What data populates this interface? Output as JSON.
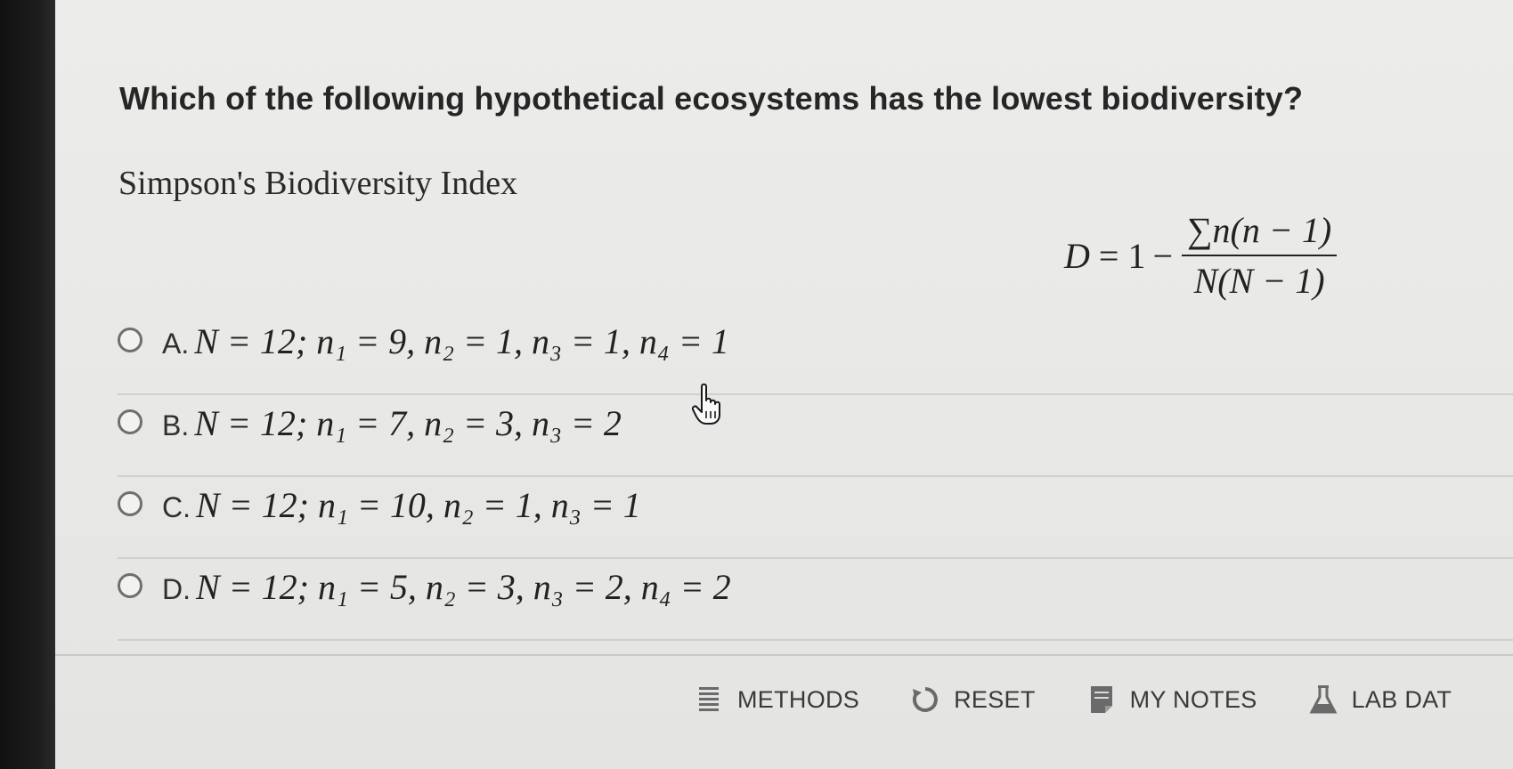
{
  "question": "Which of the following hypothetical ecosystems has the lowest biodiversity?",
  "index_title": "Simpson's Biodiversity Index",
  "formula": {
    "lhs": "D",
    "equals": "=",
    "one": "1",
    "minus": "−",
    "numerator": "∑n(n − 1)",
    "denominator": "N(N − 1)"
  },
  "options": [
    {
      "letter": "A.",
      "expression": "N = 12; n₁ = 9, n₂ = 1, n₃ = 1, n₄ = 1"
    },
    {
      "letter": "B.",
      "expression": "N = 12; n₁ = 7, n₂ = 3, n₃ = 2"
    },
    {
      "letter": "C.",
      "expression": "N = 12; n₁ = 10, n₂ = 1, n₃ = 1"
    },
    {
      "letter": "D.",
      "expression": "N = 12; n₁ = 5, n₂ = 3, n₃ = 2, n₄ = 2"
    }
  ],
  "toolbar": {
    "methods": {
      "label": "METHODS",
      "icon": "list-icon"
    },
    "reset": {
      "label": "RESET",
      "icon": "reset-icon"
    },
    "notes": {
      "label": "MY NOTES",
      "icon": "notepad-icon"
    },
    "labdata": {
      "label": "LAB DAT",
      "icon": "flask-icon"
    }
  },
  "colors": {
    "background": "#e9e9e7",
    "text": "#262626",
    "radio_border": "#6f6f6f",
    "divider": "#cfcfcd"
  }
}
